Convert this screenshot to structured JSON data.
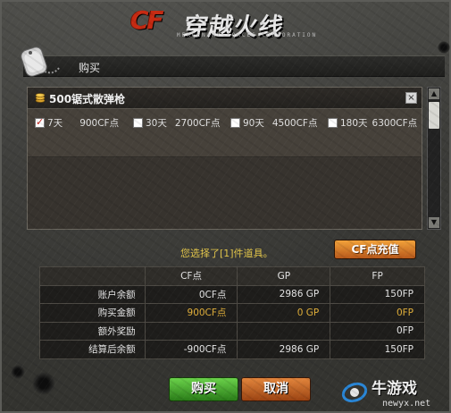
{
  "logo": {
    "cf": "CF",
    "cn": "穿越火线",
    "sub": "MERCENARY FORCES CORPORATION"
  },
  "window": {
    "title": "购买"
  },
  "item": {
    "name": "500锯式散弹枪",
    "close": "×",
    "options": [
      {
        "duration": "7天",
        "price": "900CF点",
        "checked": true
      },
      {
        "duration": "30天",
        "price": "2700CF点",
        "checked": false
      },
      {
        "duration": "90天",
        "price": "4500CF点",
        "checked": false
      },
      {
        "duration": "180天",
        "price": "6300CF点",
        "checked": false
      }
    ]
  },
  "selection": {
    "text": "您选择了[1]件道具。"
  },
  "recharge": {
    "label": "CF点充值"
  },
  "table": {
    "headers": [
      "",
      "CF点",
      "GP",
      "FP"
    ],
    "rows": [
      {
        "label": "账户余额",
        "cf": "0CF点",
        "gp": "2986 GP",
        "fp": "150FP",
        "highlight": false
      },
      {
        "label": "购买金额",
        "cf": "900CF点",
        "gp": "0 GP",
        "fp": "0FP",
        "highlight": true
      },
      {
        "label": "额外奖励",
        "cf": "",
        "gp": "",
        "fp": "0FP",
        "highlight": false
      },
      {
        "label": "结算后余额",
        "cf": "-900CF点",
        "gp": "2986 GP",
        "fp": "150FP",
        "highlight": false
      }
    ]
  },
  "buttons": {
    "buy": "购买",
    "cancel": "取消"
  },
  "watermark": {
    "name": "牛游戏",
    "url": "newyx.net"
  },
  "colors": {
    "gold": "#e2b03a",
    "buy_green": "#3a9a22",
    "cancel_orange": "#c0601e",
    "logo_red": "#c62a12"
  }
}
